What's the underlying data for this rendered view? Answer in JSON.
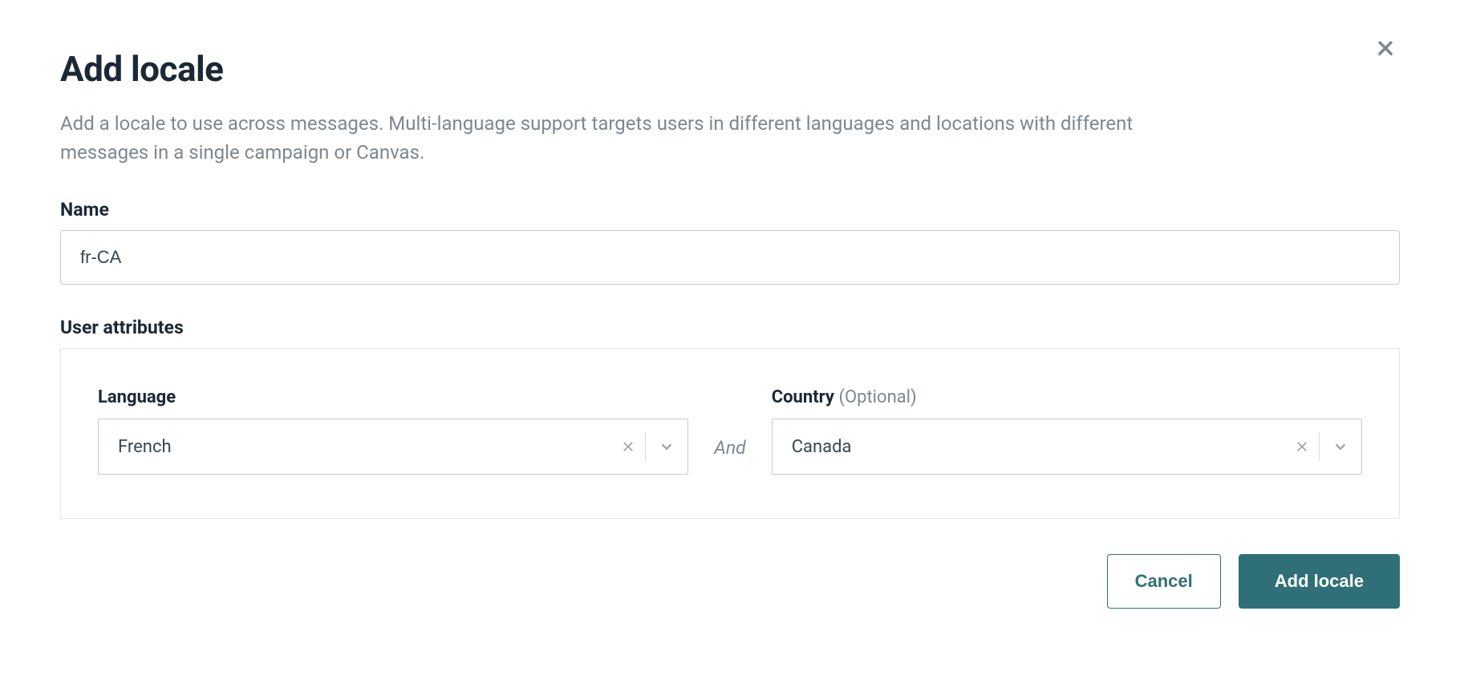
{
  "modal": {
    "title": "Add locale",
    "description": "Add a locale to use across messages. Multi-language support targets users in different languages and locations with different messages in a single campaign or Canvas."
  },
  "form": {
    "name_label": "Name",
    "name_value": "fr-CA",
    "user_attributes_label": "User attributes",
    "language_label": "Language",
    "language_value": "French",
    "and_text": "And",
    "country_label": "Country",
    "country_optional": "(Optional)",
    "country_value": "Canada"
  },
  "buttons": {
    "cancel": "Cancel",
    "submit": "Add locale"
  }
}
